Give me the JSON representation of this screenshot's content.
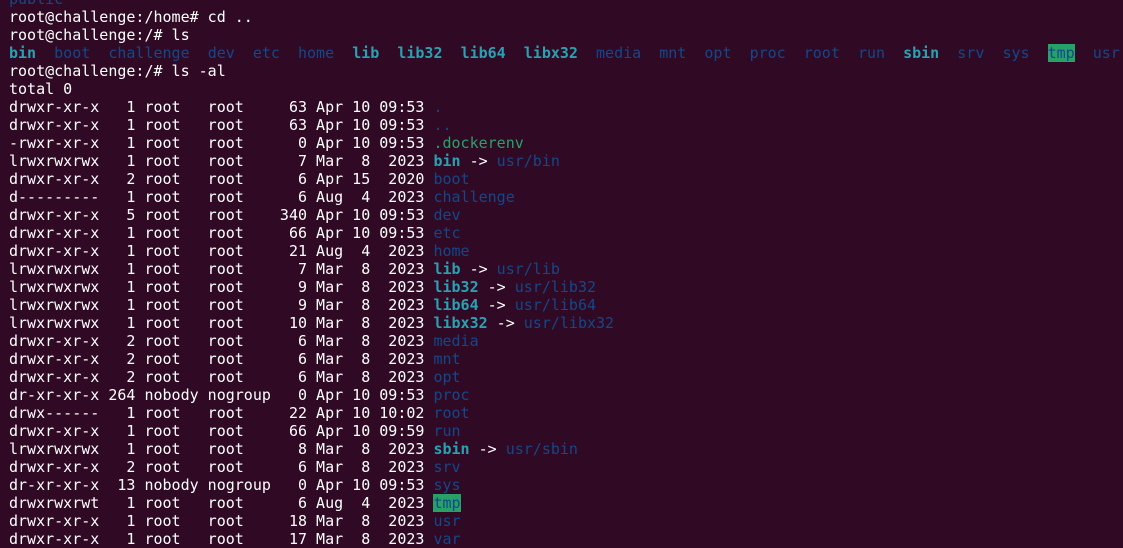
{
  "terminal": {
    "colors": {
      "background": "#300a24",
      "foreground": "#ffffff",
      "directory": "#12488b",
      "symlink": "#2aa1b3",
      "hidden_file": "#26a269",
      "sticky_dir_bg": "#26a269"
    },
    "lines": [
      [
        {
          "t": "public",
          "c": "partial"
        }
      ],
      [
        {
          "t": "root@challenge:/home# cd .."
        }
      ],
      [
        {
          "t": "root@challenge:/# ls"
        }
      ],
      [
        {
          "t": "bin",
          "c": "link"
        },
        {
          "t": "  "
        },
        {
          "t": "boot",
          "c": "dir"
        },
        {
          "t": "  "
        },
        {
          "t": "challenge",
          "c": "dir"
        },
        {
          "t": "  "
        },
        {
          "t": "dev",
          "c": "dir"
        },
        {
          "t": "  "
        },
        {
          "t": "etc",
          "c": "dir"
        },
        {
          "t": "  "
        },
        {
          "t": "home",
          "c": "dir"
        },
        {
          "t": "  "
        },
        {
          "t": "lib",
          "c": "link"
        },
        {
          "t": "  "
        },
        {
          "t": "lib32",
          "c": "link"
        },
        {
          "t": "  "
        },
        {
          "t": "lib64",
          "c": "link"
        },
        {
          "t": "  "
        },
        {
          "t": "libx32",
          "c": "link"
        },
        {
          "t": "  "
        },
        {
          "t": "media",
          "c": "dir"
        },
        {
          "t": "  "
        },
        {
          "t": "mnt",
          "c": "dir"
        },
        {
          "t": "  "
        },
        {
          "t": "opt",
          "c": "dir"
        },
        {
          "t": "  "
        },
        {
          "t": "proc",
          "c": "dir"
        },
        {
          "t": "  "
        },
        {
          "t": "root",
          "c": "dir"
        },
        {
          "t": "  "
        },
        {
          "t": "run",
          "c": "dir"
        },
        {
          "t": "  "
        },
        {
          "t": "sbin",
          "c": "link"
        },
        {
          "t": "  "
        },
        {
          "t": "srv",
          "c": "dir"
        },
        {
          "t": "  "
        },
        {
          "t": "sys",
          "c": "dir"
        },
        {
          "t": "  "
        },
        {
          "t": "tmp",
          "c": "sticky"
        },
        {
          "t": "  "
        },
        {
          "t": "usr",
          "c": "dir"
        }
      ],
      [
        {
          "t": "root@challenge:/# ls -al"
        }
      ],
      [
        {
          "t": "total 0"
        }
      ],
      [
        {
          "t": "drwxr-xr-x   1 root   root     63 Apr 10 09:53 "
        },
        {
          "t": ".",
          "c": "dir"
        }
      ],
      [
        {
          "t": "drwxr-xr-x   1 root   root     63 Apr 10 09:53 "
        },
        {
          "t": "..",
          "c": "dir"
        }
      ],
      [
        {
          "t": "-rwxr-xr-x   1 root   root      0 Apr 10 09:53 "
        },
        {
          "t": ".dockerenv",
          "c": "file"
        }
      ],
      [
        {
          "t": "lrwxrwxrwx   1 root   root      7 Mar  8  2023 "
        },
        {
          "t": "bin",
          "c": "link"
        },
        {
          "t": " -> ",
          "c": "arrow"
        },
        {
          "t": "usr/bin",
          "c": "dir"
        }
      ],
      [
        {
          "t": "drwxr-xr-x   2 root   root      6 Apr 15  2020 "
        },
        {
          "t": "boot",
          "c": "dir"
        }
      ],
      [
        {
          "t": "d---------   1 root   root      6 Aug  4  2023 "
        },
        {
          "t": "challenge",
          "c": "dir"
        }
      ],
      [
        {
          "t": "drwxr-xr-x   5 root   root    340 Apr 10 09:53 "
        },
        {
          "t": "dev",
          "c": "dir"
        }
      ],
      [
        {
          "t": "drwxr-xr-x   1 root   root     66 Apr 10 09:53 "
        },
        {
          "t": "etc",
          "c": "dir"
        }
      ],
      [
        {
          "t": "drwxr-xr-x   1 root   root     21 Aug  4  2023 "
        },
        {
          "t": "home",
          "c": "dir"
        }
      ],
      [
        {
          "t": "lrwxrwxrwx   1 root   root      7 Mar  8  2023 "
        },
        {
          "t": "lib",
          "c": "link"
        },
        {
          "t": " -> ",
          "c": "arrow"
        },
        {
          "t": "usr/lib",
          "c": "dir"
        }
      ],
      [
        {
          "t": "lrwxrwxrwx   1 root   root      9 Mar  8  2023 "
        },
        {
          "t": "lib32",
          "c": "link"
        },
        {
          "t": " -> ",
          "c": "arrow"
        },
        {
          "t": "usr/lib32",
          "c": "dir"
        }
      ],
      [
        {
          "t": "lrwxrwxrwx   1 root   root      9 Mar  8  2023 "
        },
        {
          "t": "lib64",
          "c": "link"
        },
        {
          "t": " -> ",
          "c": "arrow"
        },
        {
          "t": "usr/lib64",
          "c": "dir"
        }
      ],
      [
        {
          "t": "lrwxrwxrwx   1 root   root     10 Mar  8  2023 "
        },
        {
          "t": "libx32",
          "c": "link"
        },
        {
          "t": " -> ",
          "c": "arrow"
        },
        {
          "t": "usr/libx32",
          "c": "dir"
        }
      ],
      [
        {
          "t": "drwxr-xr-x   2 root   root      6 Mar  8  2023 "
        },
        {
          "t": "media",
          "c": "dir"
        }
      ],
      [
        {
          "t": "drwxr-xr-x   2 root   root      6 Mar  8  2023 "
        },
        {
          "t": "mnt",
          "c": "dir"
        }
      ],
      [
        {
          "t": "drwxr-xr-x   2 root   root      6 Mar  8  2023 "
        },
        {
          "t": "opt",
          "c": "dir"
        }
      ],
      [
        {
          "t": "dr-xr-xr-x 264 nobody nogroup   0 Apr 10 09:53 "
        },
        {
          "t": "proc",
          "c": "dir"
        }
      ],
      [
        {
          "t": "drwx------   1 root   root     22 Apr 10 10:02 "
        },
        {
          "t": "root",
          "c": "dir"
        }
      ],
      [
        {
          "t": "drwxr-xr-x   1 root   root     66 Apr 10 09:59 "
        },
        {
          "t": "run",
          "c": "dir"
        }
      ],
      [
        {
          "t": "lrwxrwxrwx   1 root   root      8 Mar  8  2023 "
        },
        {
          "t": "sbin",
          "c": "link"
        },
        {
          "t": " -> ",
          "c": "arrow"
        },
        {
          "t": "usr/sbin",
          "c": "dir"
        }
      ],
      [
        {
          "t": "drwxr-xr-x   2 root   root      6 Mar  8  2023 "
        },
        {
          "t": "srv",
          "c": "dir"
        }
      ],
      [
        {
          "t": "dr-xr-xr-x  13 nobody nogroup   0 Apr 10 09:53 "
        },
        {
          "t": "sys",
          "c": "dir"
        }
      ],
      [
        {
          "t": "drwxrwxrwt   1 root   root      6 Aug  4  2023 "
        },
        {
          "t": "tmp",
          "c": "sticky"
        }
      ],
      [
        {
          "t": "drwxr-xr-x   1 root   root     18 Mar  8  2023 "
        },
        {
          "t": "usr",
          "c": "dir"
        }
      ],
      [
        {
          "t": "drwxr-xr-x   1 root   root     17 Mar  8  2023 "
        },
        {
          "t": "var",
          "c": "dir"
        }
      ]
    ]
  }
}
